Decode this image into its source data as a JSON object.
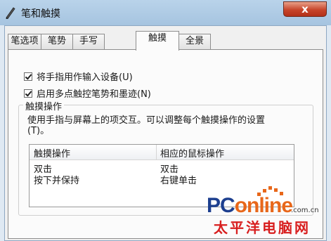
{
  "window": {
    "title": "笔和触摸",
    "close_glyph": "x"
  },
  "tabs": [
    {
      "label": "笔选项",
      "active": false
    },
    {
      "label": "笔势",
      "active": false
    },
    {
      "label": "手写",
      "active": false
    },
    {
      "label": "触摸",
      "active": true
    },
    {
      "label": "全景",
      "active": false
    }
  ],
  "options": [
    {
      "label": "将手指用作输入设备(U)",
      "checked": true
    },
    {
      "label": "启用多点触控笔势和墨迹(N)",
      "checked": true
    }
  ],
  "touch_actions": {
    "group_title": "触摸操作",
    "description": "使用手指与屏幕上的项交互。可以调整每个触摸操作的设置(T)。",
    "columns": [
      "触摸操作",
      "相应的鼠标操作"
    ],
    "rows": [
      [
        "双击",
        "双击"
      ],
      [
        "按下并保持",
        "右键单击"
      ]
    ]
  },
  "watermark": {
    "brand_a": "PC",
    "brand_b": "online",
    "domain": ".com.cn",
    "cn_text": "太平洋电脑网",
    "colors": {
      "blue": "#1d3f8f",
      "orange": "#e8671a",
      "red": "#d81e1e"
    }
  },
  "icons": {
    "title_icon": "pen-icon",
    "close_icon": "close-icon",
    "check_icon": "check-icon"
  }
}
